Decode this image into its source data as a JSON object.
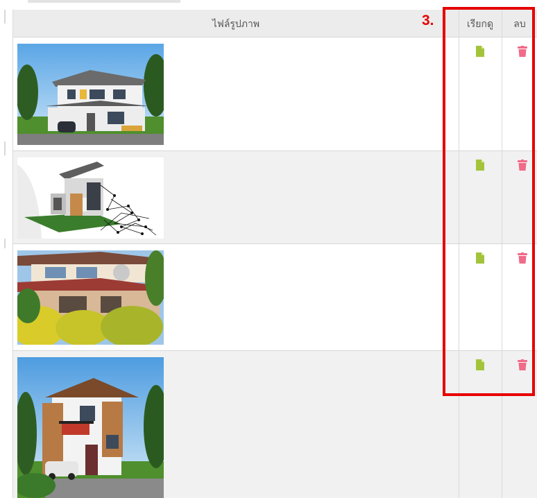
{
  "table": {
    "headers": {
      "file": "ไฟล์รูปภาพ",
      "view": "เรียกดู",
      "delete": "ลบ"
    },
    "rows": [
      {
        "image": "house-photo-1",
        "view_icon": "file-icon",
        "delete_icon": "trash-icon"
      },
      {
        "image": "house-photo-2",
        "view_icon": "file-icon",
        "delete_icon": "trash-icon"
      },
      {
        "image": "house-photo-3",
        "view_icon": "file-icon",
        "delete_icon": "trash-icon"
      },
      {
        "image": "house-photo-4",
        "view_icon": "file-icon",
        "delete_icon": "trash-icon"
      }
    ]
  },
  "annotation": {
    "number": "3.",
    "color": "#e60000"
  },
  "colors": {
    "view_icon": "#a3c43a",
    "delete_icon": "#f06a8a",
    "header_bg": "#ececec",
    "row_alt_bg": "#f1f1f1"
  }
}
